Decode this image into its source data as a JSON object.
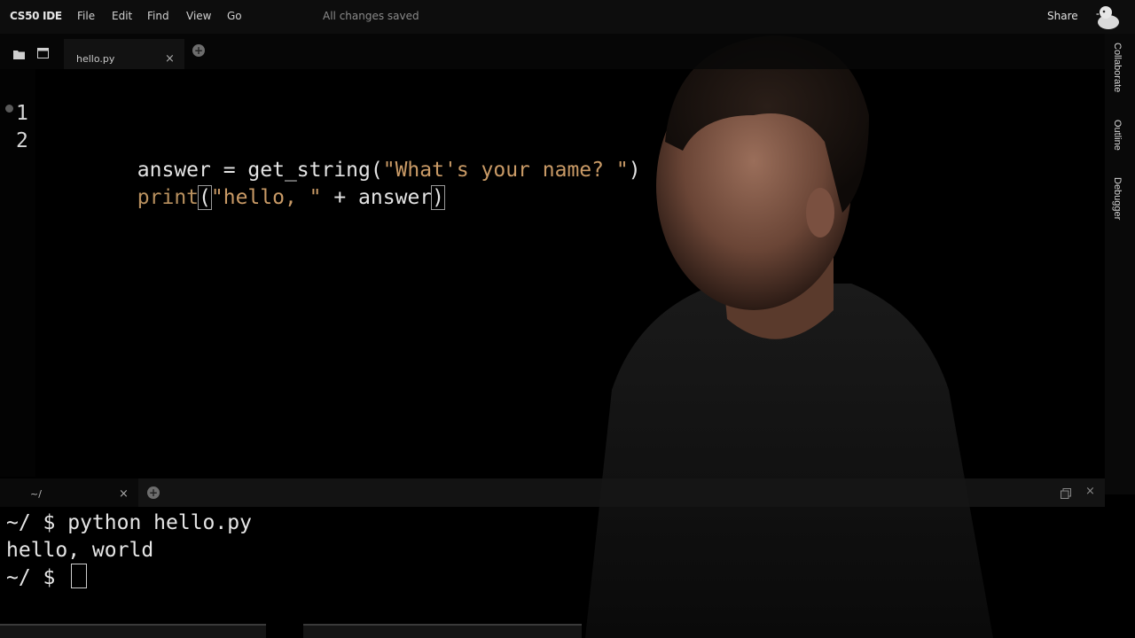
{
  "menubar": {
    "brand": "CS50 IDE",
    "items": [
      "File",
      "Edit",
      "Find",
      "View",
      "Go"
    ],
    "status": "All changes saved",
    "share": "Share"
  },
  "editor": {
    "tab": {
      "label": "hello.py",
      "close": "×"
    },
    "add_tab": "+",
    "lines": [
      {
        "num": "1",
        "tokens": [
          {
            "t": "answer = get_string(",
            "c": "plain"
          },
          {
            "t": "\"What's your name? \"",
            "c": "str"
          },
          {
            "t": ")",
            "c": "plain"
          }
        ]
      },
      {
        "num": "2",
        "tokens": [
          {
            "t": "print",
            "c": "kw"
          },
          {
            "t": "(",
            "c": "plain",
            "box": true
          },
          {
            "t": "\"hello, \"",
            "c": "str"
          },
          {
            "t": " + answer",
            "c": "plain"
          },
          {
            "t": ")",
            "c": "plain",
            "box": true
          }
        ]
      }
    ]
  },
  "side_panel": {
    "items": [
      "Collaborate",
      "Outline",
      "Debugger"
    ]
  },
  "terminal": {
    "tab": {
      "label": "~/",
      "close": "×"
    },
    "add_tab": "+",
    "close": "×",
    "lines": [
      "~/ $ python hello.py",
      "hello, world",
      "~/ $ "
    ]
  },
  "colors": {
    "keyword": "#b9915f",
    "string": "#c99a66",
    "text": "#e4e4e4"
  }
}
